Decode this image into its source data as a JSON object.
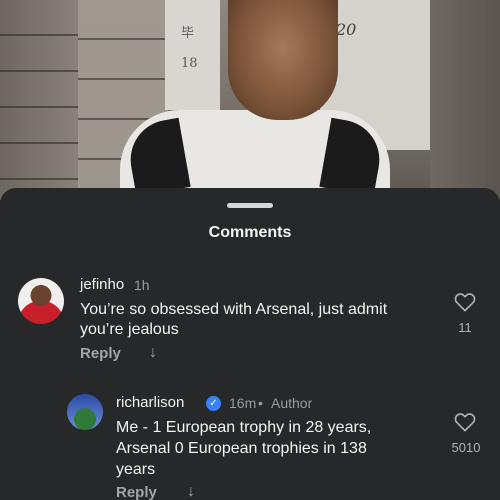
{
  "background": {
    "locker_number": "20",
    "locker_glyph_1": "毕",
    "locker_glyph_2": "18"
  },
  "sheet": {
    "title": "Comments"
  },
  "comments": [
    {
      "username": "jefinho",
      "time": "1h",
      "text_line_1": "You’re so obsessed with Arsenal, just admit",
      "text_line_2": "you’re jealous",
      "reply_label": "Reply",
      "reply_arrow": "↓",
      "likes": "11"
    },
    {
      "username": "richarlison",
      "time": "16m",
      "separator": "•",
      "author_badge": "Author",
      "text_line_1": "Me - 1 European trophy in 28 years,",
      "text_line_2": "Arsenal 0 European trophies in 138",
      "text_line_3": "years",
      "reply_label": "Reply",
      "reply_arrow": "↓",
      "likes": "5010"
    }
  ],
  "colors": {
    "sheet_bg": "#262829",
    "verified_blue": "#3b82f6"
  }
}
